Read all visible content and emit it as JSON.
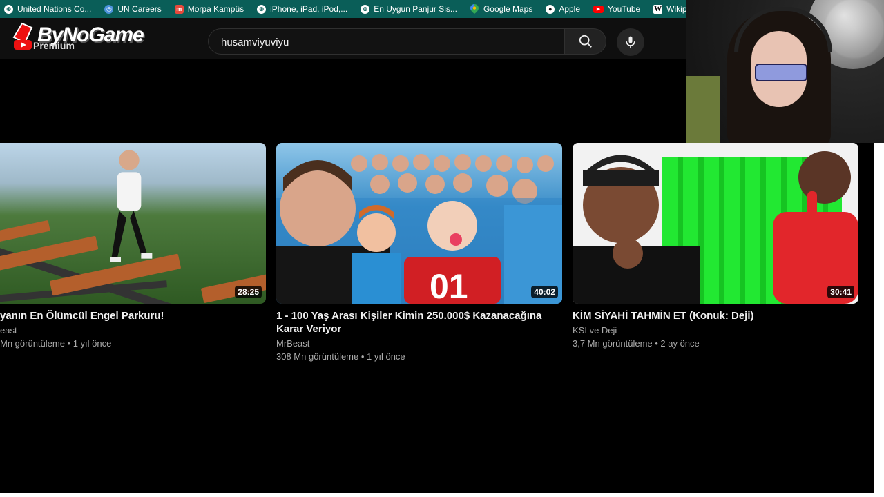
{
  "bookmarks": [
    {
      "label": "United Nations Co...",
      "icon": "globe-icon"
    },
    {
      "label": "UN Careers",
      "icon": "un-logo-icon"
    },
    {
      "label": "Morpa Kampüs",
      "icon": "morpa-icon"
    },
    {
      "label": "iPhone, iPad, iPod,...",
      "icon": "globe-icon"
    },
    {
      "label": "En Uygun Panjur Sis...",
      "icon": "globe-icon"
    },
    {
      "label": "Google Maps",
      "icon": "maps-pin-icon"
    },
    {
      "label": "Apple",
      "icon": "globe-icon"
    },
    {
      "label": "YouTube",
      "icon": "youtube-icon"
    },
    {
      "label": "Wikipedia",
      "icon": "wikipedia-icon"
    }
  ],
  "header": {
    "logo_text": "ByNoGame",
    "logo_sub": "Premium",
    "search_value": "husamviyuviyu"
  },
  "videos": [
    {
      "title": "yanın En Ölümcül Engel Parkuru!",
      "channel": "east",
      "meta": "Mn görüntüleme • 1 yıl önce",
      "duration": "28:25"
    },
    {
      "title": "1 - 100 Yaş Arası Kişiler Kimin 250.000$ Kazanacağına Karar Veriyor",
      "channel": "MrBeast",
      "meta": "308 Mn görüntüleme • 1 yıl önce",
      "duration": "40:02",
      "thumb_badge": "01"
    },
    {
      "title": "KİM SİYAHİ TAHMİN ET (Konuk: Deji)",
      "channel": "KSI ve Deji",
      "meta": "3,7 Mn görüntüleme • 2 ay önce",
      "duration": "30:41"
    }
  ],
  "colors": {
    "bookmarks_bg": "#0a5e58",
    "header_bg": "#0f0f0f",
    "page_bg": "#000000",
    "meta_text": "#aaaaaa"
  }
}
